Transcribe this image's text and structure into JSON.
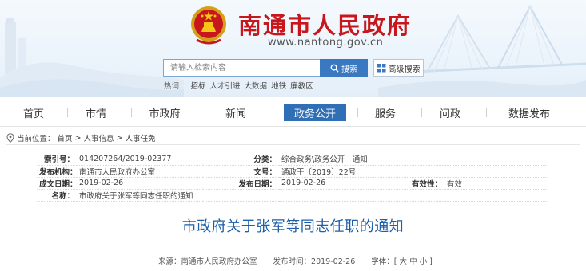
{
  "site": {
    "title": "南通市人民政府",
    "url": "www.nantong.gov.cn"
  },
  "search": {
    "placeholder": "请输入检索内容",
    "button_label": "搜索",
    "advanced_label": "高级搜索",
    "hot_label": "热词：",
    "hot_words": [
      "招标",
      "人才引进",
      "大数据",
      "地铁",
      "廉教区"
    ]
  },
  "nav": {
    "items": [
      "首页",
      "市情",
      "市政府",
      "新闻",
      "政务公开",
      "服务",
      "问政",
      "数据发布"
    ],
    "active_index": 4
  },
  "breadcrumb": {
    "prefix": "当前位置：",
    "items": [
      "首页",
      "人事信息",
      "人事任免"
    ],
    "separator": ">"
  },
  "info": {
    "index_label": "索引号：",
    "index_value": "014207264/2019-02377",
    "category_label": "分类：",
    "category_value": "综合政务\\政务公开　通知",
    "publisher_label": "发布机构：",
    "publisher_value": "南通市人民政府办公室",
    "docno_label": "文号：",
    "docno_value": "通政干〔2019〕22号",
    "created_label": "成文日期：",
    "created_value": "2019-02-26",
    "published_label": "发布日期：",
    "published_value": "2019-02-26",
    "validity_label": "有效性：",
    "validity_value": "有效",
    "name_label": "名称：",
    "name_value": "市政府关于张军等同志任职的通知"
  },
  "article": {
    "title": "市政府关于张军等同志任职的通知",
    "source_label": "来源：",
    "source_value": "南通市人民政府办公室",
    "time_label": "发布时间：",
    "time_value": "2019-02-26",
    "font_label": "字体：",
    "font_open": "[",
    "font_large": "大",
    "font_medium": "中",
    "font_small": "小",
    "font_close": "]"
  },
  "colors": {
    "brand_red": "#c8161d",
    "nav_active": "#2f6fb5",
    "title_blue": "#1d5fa8"
  }
}
